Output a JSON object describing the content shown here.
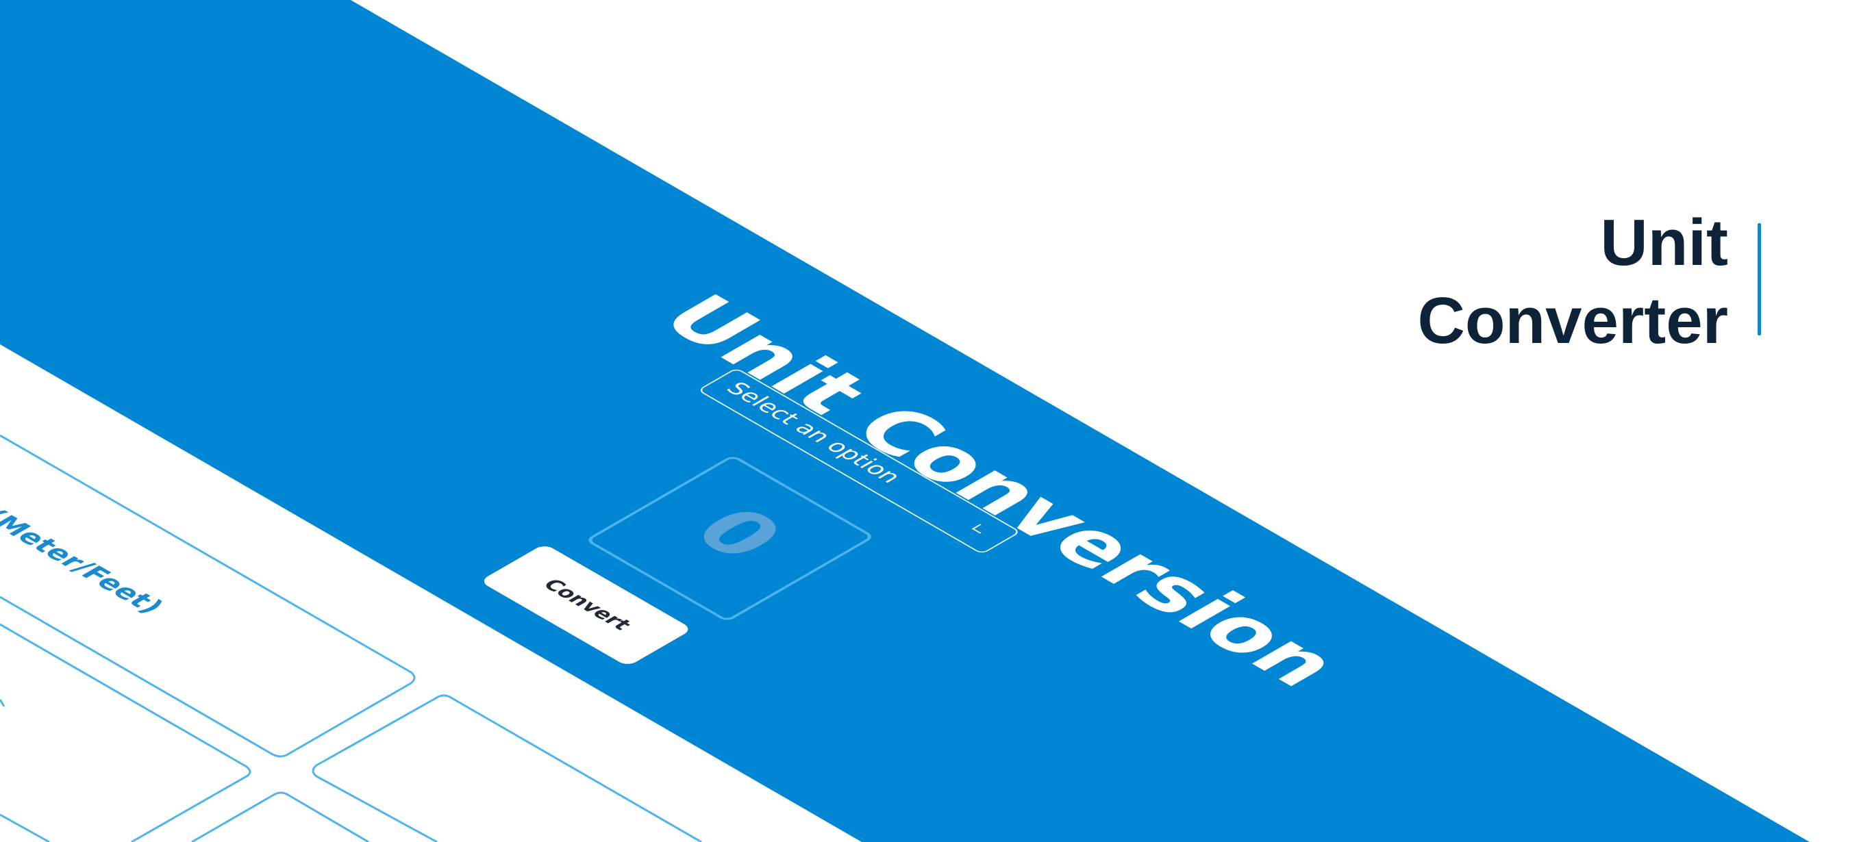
{
  "colors": {
    "background": "#ffffff",
    "panel_blue": "#0086d3",
    "outline_blue": "#4fb4ee",
    "heading": "#0e2238",
    "accent_bar": "#1486c9"
  },
  "panel": {
    "title": "Unit Conversion",
    "select": {
      "placeholder": "Select an option",
      "icon": "chevron-down-icon"
    },
    "value_display": "0",
    "convert_button": "Convert"
  },
  "side_panel": {
    "label": "(Meter/Feet)"
  },
  "heading": {
    "line1": "Unit",
    "line2": "Converter"
  }
}
